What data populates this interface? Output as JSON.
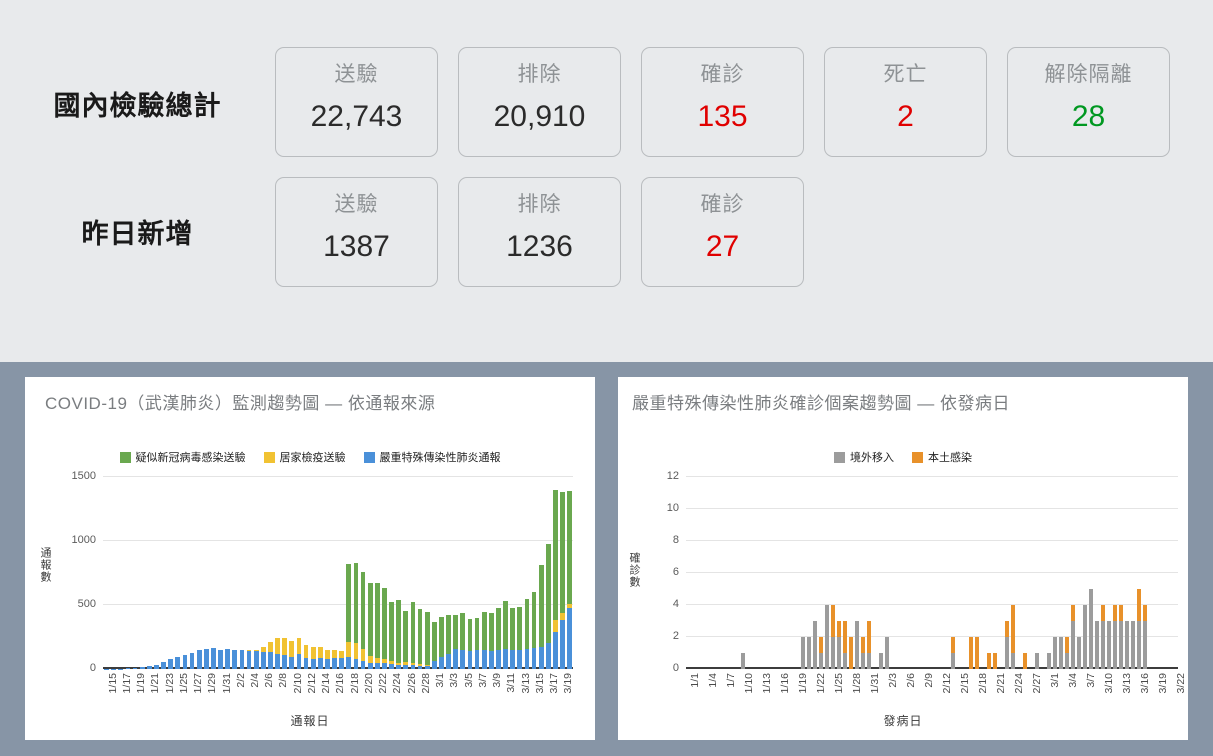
{
  "summary": {
    "rows": [
      {
        "label": "國內檢驗總計",
        "cards": [
          {
            "title": "送驗",
            "value": "22,743",
            "color": "default"
          },
          {
            "title": "排除",
            "value": "20,910",
            "color": "default"
          },
          {
            "title": "確診",
            "value": "135",
            "color": "red"
          },
          {
            "title": "死亡",
            "value": "2",
            "color": "red"
          },
          {
            "title": "解除隔離",
            "value": "28",
            "color": "green"
          }
        ]
      },
      {
        "label": "昨日新增",
        "cards": [
          {
            "title": "送驗",
            "value": "1387",
            "color": "default"
          },
          {
            "title": "排除",
            "value": "1236",
            "color": "default"
          },
          {
            "title": "確診",
            "value": "27",
            "color": "red"
          }
        ]
      }
    ],
    "colors": {
      "red": "#e00000",
      "green": "#009821",
      "default": "#2b2b2b"
    }
  },
  "chart_data": [
    {
      "id": "reporting-source",
      "type": "bar",
      "stacked": true,
      "title": "COVID-19（武漢肺炎）監測趨勢圖 — 依通報來源",
      "xlabel": "通報日",
      "ylabel": "通報數",
      "ylim": [
        0,
        1500
      ],
      "yticks": [
        0,
        500,
        1000,
        1500
      ],
      "grid": true,
      "legend_position": "top-center",
      "legend": [
        "疑似新冠病毒感染送驗",
        "居家檢疫送驗",
        "嚴重特殊傳染性肺炎通報"
      ],
      "colors": [
        "#6aa84f",
        "#f1c232",
        "#4a90d9"
      ],
      "tick_labels": [
        "1/15",
        "1/17",
        "1/19",
        "1/21",
        "1/23",
        "1/25",
        "1/27",
        "1/29",
        "1/31",
        "2/2",
        "2/4",
        "2/6",
        "2/8",
        "2/10",
        "2/12",
        "2/14",
        "2/16",
        "2/18",
        "2/20",
        "2/22",
        "2/24",
        "2/26",
        "2/28",
        "3/1",
        "3/3",
        "3/5",
        "3/7",
        "3/9",
        "3/11",
        "3/13",
        "3/15",
        "3/17",
        "3/19"
      ],
      "x": [
        "1/15",
        "1/16",
        "1/17",
        "1/18",
        "1/19",
        "1/20",
        "1/21",
        "1/22",
        "1/23",
        "1/24",
        "1/25",
        "1/26",
        "1/27",
        "1/28",
        "1/29",
        "1/30",
        "1/31",
        "2/1",
        "2/2",
        "2/3",
        "2/4",
        "2/5",
        "2/6",
        "2/7",
        "2/8",
        "2/9",
        "2/10",
        "2/11",
        "2/12",
        "2/13",
        "2/14",
        "2/15",
        "2/16",
        "2/17",
        "2/18",
        "2/19",
        "2/20",
        "2/21",
        "2/22",
        "2/23",
        "2/24",
        "2/25",
        "2/26",
        "2/27",
        "2/28",
        "2/29",
        "3/1",
        "3/2",
        "3/3",
        "3/4",
        "3/5",
        "3/6",
        "3/7",
        "3/8",
        "3/9",
        "3/10",
        "3/11",
        "3/12",
        "3/13",
        "3/14",
        "3/15",
        "3/16",
        "3/17",
        "3/18",
        "3/19",
        "3/20"
      ],
      "series": [
        {
          "name": "嚴重特殊傳染性肺炎通報",
          "color": "#4a90d9",
          "values": [
            2,
            3,
            4,
            5,
            8,
            12,
            20,
            35,
            55,
            75,
            95,
            110,
            125,
            150,
            160,
            165,
            150,
            155,
            150,
            145,
            140,
            140,
            135,
            135,
            120,
            110,
            95,
            120,
            85,
            80,
            85,
            80,
            85,
            85,
            90,
            75,
            60,
            50,
            50,
            45,
            40,
            35,
            35,
            30,
            25,
            20,
            60,
            95,
            120,
            160,
            150,
            140,
            150,
            145,
            140,
            150,
            160,
            150,
            145,
            155,
            165,
            170,
            200,
            290,
            380,
            480
          ]
        },
        {
          "name": "居家檢疫送驗",
          "color": "#f1c232",
          "values": [
            0,
            0,
            0,
            0,
            0,
            0,
            0,
            0,
            0,
            0,
            0,
            0,
            0,
            0,
            0,
            0,
            0,
            0,
            0,
            0,
            5,
            10,
            40,
            80,
            120,
            130,
            120,
            125,
            100,
            90,
            90,
            70,
            60,
            55,
            120,
            130,
            95,
            55,
            40,
            30,
            25,
            15,
            20,
            15,
            12,
            8,
            5,
            0,
            0,
            0,
            0,
            0,
            0,
            0,
            0,
            0,
            0,
            0,
            0,
            0,
            0,
            0,
            0,
            90,
            60,
            30
          ]
        },
        {
          "name": "疑似新冠病毒感染送驗",
          "color": "#6aa84f",
          "values": [
            0,
            0,
            0,
            0,
            0,
            0,
            0,
            0,
            0,
            0,
            0,
            0,
            0,
            0,
            0,
            0,
            0,
            0,
            0,
            0,
            0,
            0,
            0,
            0,
            0,
            0,
            0,
            0,
            0,
            0,
            0,
            0,
            0,
            0,
            610,
            620,
            600,
            570,
            580,
            560,
            460,
            490,
            400,
            480,
            430,
            420,
            300,
            310,
            300,
            260,
            290,
            250,
            250,
            300,
            300,
            330,
            370,
            330,
            340,
            390,
            440,
            640,
            780,
            1020,
            940,
            880
          ]
        }
      ]
    },
    {
      "id": "confirmed-onset",
      "type": "bar",
      "stacked": true,
      "title": "嚴重特殊傳染性肺炎確診個案趨勢圖 — 依發病日",
      "xlabel": "發病日",
      "ylabel": "確診數",
      "ylim": [
        0,
        12
      ],
      "yticks": [
        0,
        2,
        4,
        6,
        8,
        10,
        12
      ],
      "grid": true,
      "legend_position": "top-center",
      "legend": [
        "境外移入",
        "本土感染"
      ],
      "colors": [
        "#9c9c9c",
        "#e8912a"
      ],
      "tick_labels": [
        "1/1",
        "1/4",
        "1/7",
        "1/10",
        "1/13",
        "1/16",
        "1/19",
        "1/22",
        "1/25",
        "1/28",
        "1/31",
        "2/3",
        "2/6",
        "2/9",
        "2/12",
        "2/15",
        "2/18",
        "2/21",
        "2/24",
        "2/27",
        "3/1",
        "3/4",
        "3/7",
        "3/10",
        "3/13",
        "3/16",
        "3/19",
        "3/22"
      ],
      "x": [
        "1/1",
        "1/2",
        "1/3",
        "1/4",
        "1/5",
        "1/6",
        "1/7",
        "1/8",
        "1/9",
        "1/10",
        "1/11",
        "1/12",
        "1/13",
        "1/14",
        "1/15",
        "1/16",
        "1/17",
        "1/18",
        "1/19",
        "1/20",
        "1/21",
        "1/22",
        "1/23",
        "1/24",
        "1/25",
        "1/26",
        "1/27",
        "1/28",
        "1/29",
        "1/30",
        "1/31",
        "2/1",
        "2/2",
        "2/3",
        "2/4",
        "2/5",
        "2/6",
        "2/7",
        "2/8",
        "2/9",
        "2/10",
        "2/11",
        "2/12",
        "2/13",
        "2/14",
        "2/15",
        "2/16",
        "2/17",
        "2/18",
        "2/19",
        "2/20",
        "2/21",
        "2/22",
        "2/23",
        "2/24",
        "2/25",
        "2/26",
        "2/27",
        "2/28",
        "2/29",
        "3/1",
        "3/2",
        "3/3",
        "3/4",
        "3/5",
        "3/6",
        "3/7",
        "3/8",
        "3/9",
        "3/10",
        "3/11",
        "3/12",
        "3/13",
        "3/14",
        "3/15",
        "3/16",
        "3/17",
        "3/18",
        "3/19",
        "3/20",
        "3/21",
        "3/22"
      ],
      "series": [
        {
          "name": "境外移入",
          "color": "#9c9c9c",
          "values": [
            0,
            0,
            0,
            0,
            0,
            0,
            0,
            0,
            0,
            1,
            0,
            0,
            0,
            0,
            0,
            0,
            0,
            0,
            0,
            2,
            2,
            3,
            1,
            4,
            2,
            2,
            1,
            0,
            3,
            1,
            1,
            0,
            1,
            2,
            0,
            0,
            0,
            0,
            0,
            0,
            0,
            0,
            0,
            0,
            1,
            0,
            0,
            0,
            0,
            0,
            0,
            0,
            0,
            2,
            1,
            0,
            0,
            0,
            1,
            0,
            1,
            2,
            2,
            1,
            3,
            2,
            4,
            5,
            3,
            3,
            3,
            3,
            3,
            3,
            3,
            3,
            3,
            0,
            0,
            0,
            0,
            0
          ]
        },
        {
          "name": "本土感染",
          "color": "#e8912a",
          "values": [
            0,
            0,
            0,
            0,
            0,
            0,
            0,
            0,
            0,
            0,
            0,
            0,
            0,
            0,
            0,
            0,
            0,
            0,
            0,
            0,
            0,
            0,
            1,
            0,
            2,
            1,
            2,
            2,
            0,
            1,
            2,
            0,
            0,
            0,
            0,
            0,
            0,
            0,
            0,
            0,
            0,
            0,
            0,
            0,
            1,
            0,
            0,
            2,
            2,
            0,
            1,
            1,
            0,
            1,
            3,
            0,
            1,
            0,
            0,
            0,
            0,
            0,
            0,
            1,
            1,
            0,
            0,
            0,
            0,
            1,
            0,
            1,
            1,
            0,
            0,
            2,
            1,
            0,
            0,
            0,
            0,
            0
          ]
        }
      ]
    }
  ]
}
